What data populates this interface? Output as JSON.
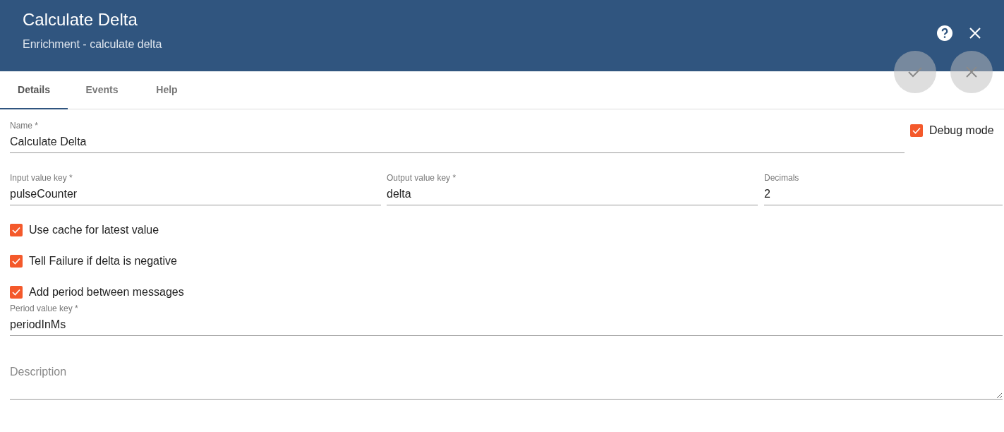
{
  "header": {
    "title": "Calculate Delta",
    "subtitle": "Enrichment - calculate delta"
  },
  "tabs": [
    {
      "label": "Details",
      "selected": true
    },
    {
      "label": "Events",
      "selected": false
    },
    {
      "label": "Help",
      "selected": false
    }
  ],
  "name_field": {
    "label": "Name *",
    "value": "Calculate Delta"
  },
  "debug_mode": {
    "label": "Debug mode",
    "checked": true
  },
  "key_fields": [
    {
      "label": "Input value key *",
      "value": "pulseCounter"
    },
    {
      "label": "Output value key *",
      "value": "delta"
    },
    {
      "label": "Decimals",
      "value": "2"
    }
  ],
  "options": [
    {
      "label": "Use cache for latest value",
      "checked": true
    },
    {
      "label": "Tell Failure if delta is negative",
      "checked": true
    },
    {
      "label": "Add period between messages",
      "checked": true
    }
  ],
  "period_field": {
    "label": "Period value key *",
    "value": "periodInMs"
  },
  "description": {
    "placeholder": "Description"
  }
}
